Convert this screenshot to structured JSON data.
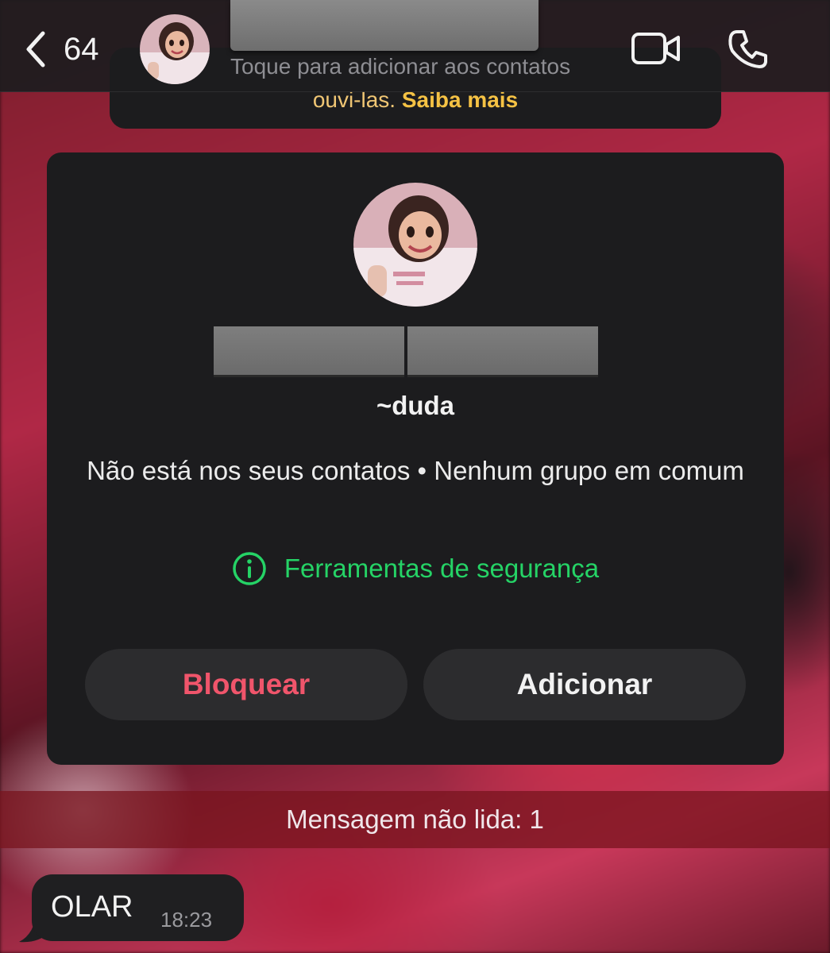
{
  "header": {
    "back_count": "64",
    "subtitle": "Toque para adicionar aos contatos"
  },
  "info_banner": {
    "text": "ouvi-las.",
    "link": "Saiba mais"
  },
  "contact_card": {
    "pushname": "~duda",
    "status": "Não está nos seus contatos • Nenhum grupo em comum",
    "safety_link": "Ferramentas de segurança",
    "block_label": "Bloquear",
    "add_label": "Adicionar"
  },
  "unread_banner": "Mensagem não lida: 1",
  "message": {
    "text": "OLAR",
    "time": "18:23"
  },
  "colors": {
    "accent_green": "#25d366",
    "danger_red": "#f0556b",
    "card_bg": "#1c1c1e",
    "button_bg": "#2c2c2e",
    "info_yellow": "#f5c244"
  },
  "icons": {
    "back": "chevron-left-icon",
    "video": "video-camera-icon",
    "phone": "phone-icon",
    "info": "info-circle-icon"
  }
}
